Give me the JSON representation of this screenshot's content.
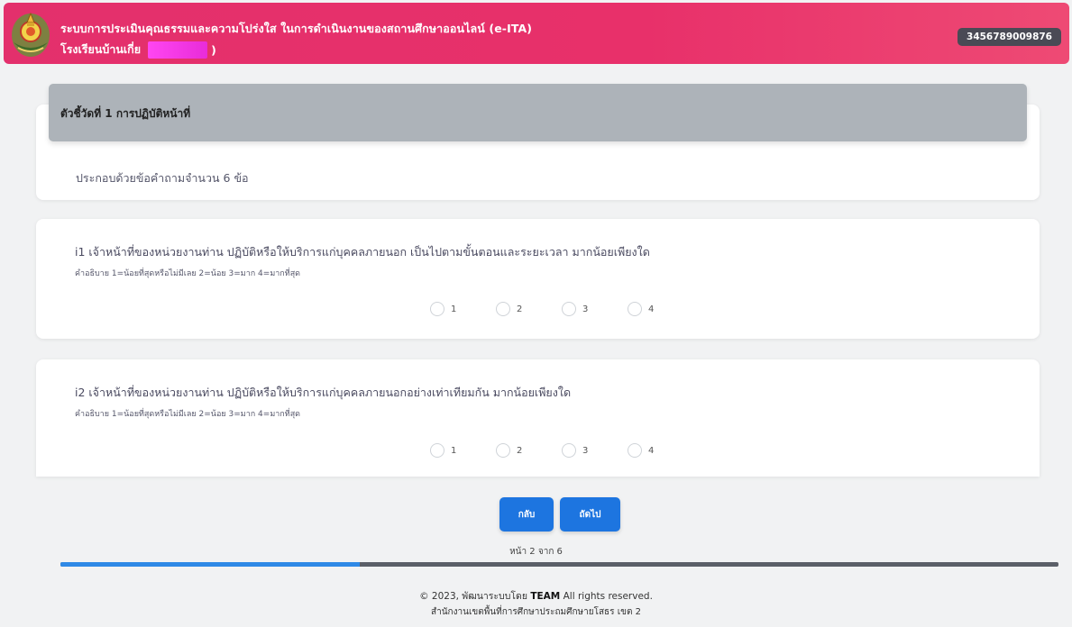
{
  "header": {
    "title": "ระบบการประเมินคุณธรรมและความโปร่งใส ในการดำเนินงานของสถานศึกษาออนไลน์ (e-ITA)",
    "school_prefix": "โรงเรียนบ้านเกี่ย",
    "school_suffix": ")",
    "id_number": "3456789009876",
    "colors": {
      "header_bg": "#e3306c",
      "badge_bg": "#4a4a55"
    }
  },
  "indicator": {
    "title": "ตัวชี้วัดที่ 1 การปฏิบัติหน้าที่",
    "description": "ประกอบด้วยข้อคำถามจำนวน 6 ข้อ"
  },
  "questions": [
    {
      "text": "i1 เจ้าหน้าที่ของหน่วยงานท่าน ปฏิบัติหรือให้บริการแก่บุคคลภายนอก เป็นไปตามขั้นตอนและระยะเวลา มากน้อยเพียงใด",
      "hint": "คำอธิบาย 1=น้อยที่สุดหรือไม่มีเลย 2=น้อย 3=มาก 4=มากที่สุด",
      "options": [
        "1",
        "2",
        "3",
        "4"
      ]
    },
    {
      "text": "i2 เจ้าหน้าที่ของหน่วยงานท่าน ปฏิบัติหรือให้บริการแก่บุคคลภายนอกอย่างเท่าเทียมกัน มากน้อยเพียงใด",
      "hint": "คำอธิบาย 1=น้อยที่สุดหรือไม่มีเลย 2=น้อย 3=มาก 4=มากที่สุด",
      "options": [
        "1",
        "2",
        "3",
        "4"
      ]
    }
  ],
  "nav": {
    "back_label": "กลับ",
    "next_label": "ถัดไป",
    "page_info": "หน้า 2 จาก 6",
    "progress_fraction": 0.3
  },
  "footer": {
    "copyright_prefix": "© 2023, พัฒนาระบบโดย",
    "team": "TEAM",
    "copyright_suffix": "All rights reserved.",
    "office": "สำนักงานเขตพื้นที่การศึกษาประถมศึกษายโสธร เขต 2"
  }
}
